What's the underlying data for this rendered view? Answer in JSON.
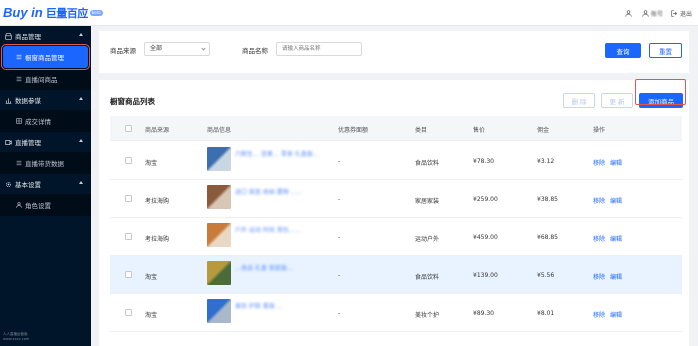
{
  "logo": {
    "en": "Buy in",
    "zh": "巨量百应",
    "badge": "beta"
  },
  "topbar": {
    "items": [
      {
        "icon": "user-icon",
        "label": ""
      },
      {
        "icon": "user-icon",
        "label": "账号"
      },
      {
        "icon": "logout-icon",
        "label": "退出"
      }
    ]
  },
  "sidebar": {
    "groups": [
      {
        "icon": "shop-icon",
        "label": "商品管理",
        "items": [
          {
            "icon": "list-icon",
            "label": "橱窗商品管理",
            "active": true
          },
          {
            "icon": "list-icon",
            "label": "直播间商品",
            "active": false
          }
        ]
      },
      {
        "icon": "chart-icon",
        "label": "数据参谋",
        "items": [
          {
            "icon": "table-icon",
            "label": "成交详情",
            "active": false
          }
        ]
      },
      {
        "icon": "video-icon",
        "label": "直播管理",
        "items": [
          {
            "icon": "list-icon",
            "label": "直播带货数据",
            "active": false
          }
        ]
      },
      {
        "icon": "gear-icon",
        "label": "基本设置",
        "items": [
          {
            "icon": "person-icon",
            "label": "角色设置",
            "active": false
          }
        ]
      }
    ],
    "footer": [
      "人人直播运营版",
      "www.xxxx.com"
    ]
  },
  "filter": {
    "source_label": "商品来源",
    "source_value": "全部",
    "name_label": "商品名称",
    "name_placeholder": "请输入商品名称",
    "query_btn": "查询",
    "reset_btn": "重置"
  },
  "list": {
    "title": "橱窗商品列表",
    "delete_btn": "删 除",
    "update_btn": "更 新",
    "add_btn": "添加商品",
    "columns": [
      "商品来源",
      "商品信息",
      "优惠券面额",
      "类目",
      "售价",
      "佣金",
      "操作"
    ],
    "rows": [
      {
        "source": "淘宝",
        "name": "六鲜生… 坚果… 零食 礼盒装…",
        "coupon": "-",
        "category": "食品饮料",
        "price": "¥78.30",
        "commission": "¥3.12",
        "actions": [
          "移除",
          "编辑"
        ],
        "highlight": false,
        "colors": [
          "#3b6fb0",
          "#c9d6e3"
        ]
      },
      {
        "source": "考拉海购",
        "name": "进口 家居 收纳 置物 ……",
        "coupon": "-",
        "category": "家居家装",
        "price": "¥259.00",
        "commission": "¥38.85",
        "actions": [
          "移除",
          "编辑"
        ],
        "highlight": false,
        "colors": [
          "#8a5a3a",
          "#d8c7b4"
        ]
      },
      {
        "source": "考拉海购",
        "name": "户外 运动 时尚 背包……",
        "coupon": "-",
        "category": "运动户外",
        "price": "¥459.00",
        "commission": "¥68.85",
        "actions": [
          "移除",
          "编辑"
        ],
        "highlight": false,
        "colors": [
          "#c97b3c",
          "#e9d9c4"
        ]
      },
      {
        "source": "淘宝",
        "name": "…食品 礼盒 家庭装…",
        "coupon": "-",
        "category": "食品饮料",
        "price": "¥139.00",
        "commission": "¥5.56",
        "actions": [
          "移除",
          "编辑"
        ],
        "highlight": true,
        "colors": [
          "#b89a3e",
          "#4b6b3a"
        ]
      },
      {
        "source": "淘宝",
        "name": "美妆 护肤 套装 …",
        "coupon": "-",
        "category": "美妆个护",
        "price": "¥89.30",
        "commission": "¥8.01",
        "actions": [
          "移除",
          "编辑"
        ],
        "highlight": false,
        "colors": [
          "#2f6fd0",
          "#aab8cc"
        ]
      }
    ]
  },
  "colors": {
    "primary": "#1a66ff",
    "sidebar_bg": "#001529",
    "highlight_row": "#e8f3ff",
    "annotation_red": "#e2564a"
  }
}
